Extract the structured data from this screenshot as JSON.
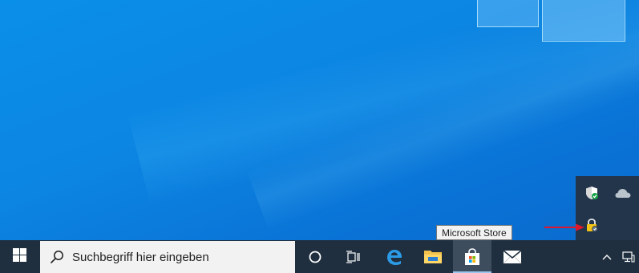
{
  "desktop": {
    "wallpaper": "windows-10-hero-blue",
    "accent_color": "#0a8fe8"
  },
  "tooltip": {
    "text": "Microsoft Store"
  },
  "tray_flyout": {
    "icons": [
      "windows-security-icon",
      "onedrive-icon",
      "bitlocker-lock-icon"
    ],
    "annotation_arrow_color": "#e0182d"
  },
  "taskbar": {
    "background": "#1f2f3f",
    "search": {
      "placeholder": "Suchbegriff hier eingeben"
    },
    "pinned": [
      "cortana-icon",
      "task-view-icon",
      "edge-icon",
      "file-explorer-icon",
      "microsoft-store-icon",
      "mail-icon"
    ],
    "active_item": "microsoft-store-icon"
  }
}
